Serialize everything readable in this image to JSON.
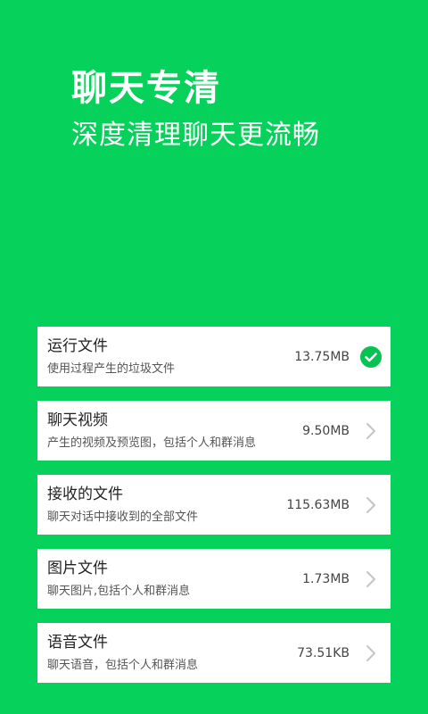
{
  "hero": {
    "title": "聊天专清",
    "subtitle": "深度清理聊天更流畅"
  },
  "items": [
    {
      "title": "运行文件",
      "desc": "使用过程产生的垃圾文件",
      "size": "13.75MB",
      "icon": "check-circle-icon"
    },
    {
      "title": "聊天视频",
      "desc": "产生的视频及预览图，包括个人和群消息",
      "size": "9.50MB",
      "icon": "chevron-right-icon"
    },
    {
      "title": "接收的文件",
      "desc": "聊天对话中接收到的全部文件",
      "size": "115.63MB",
      "icon": "chevron-right-icon"
    },
    {
      "title": "图片文件",
      "desc": "聊天图片,包括个人和群消息",
      "size": "1.73MB",
      "icon": "chevron-right-icon"
    },
    {
      "title": "语音文件",
      "desc": "聊天语音，包括个人和群消息",
      "size": "73.51KB",
      "icon": "chevron-right-icon"
    }
  ],
  "colors": {
    "background": "#06d15a",
    "accent": "#06c253",
    "card": "#ffffff"
  }
}
